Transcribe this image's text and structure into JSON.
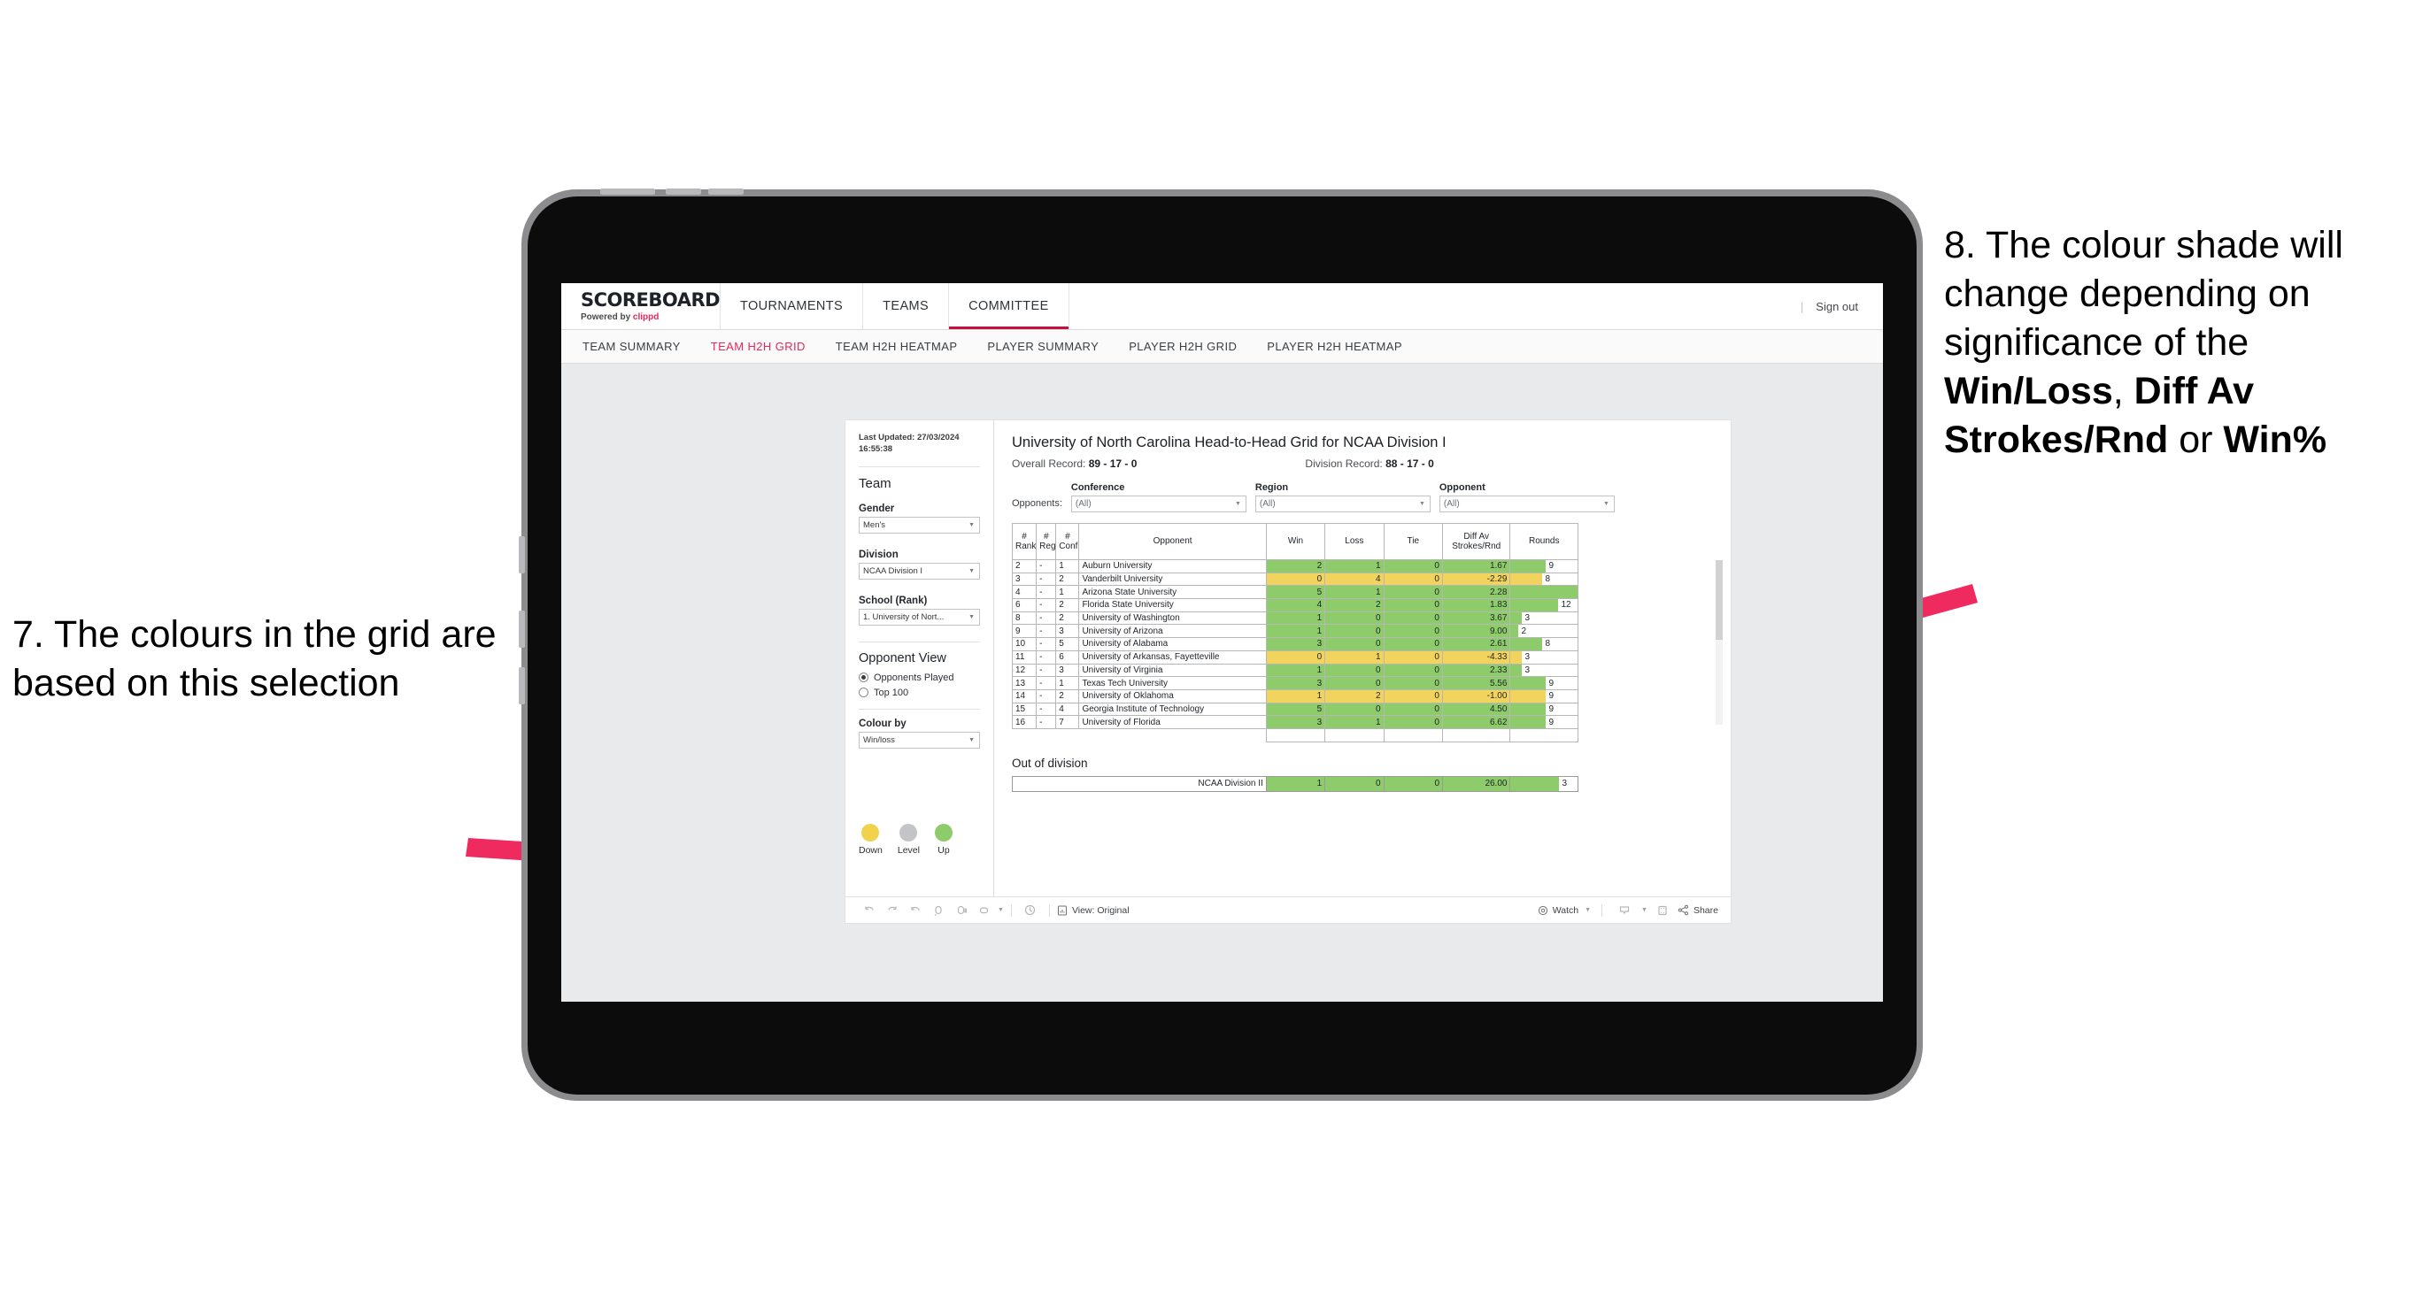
{
  "annotations": {
    "left": "7. The colours in the grid are based on this selection",
    "right_pre": "8. The colour shade will change depending on significance of the ",
    "right_b1": "Win/Loss",
    "right_mid1": ", ",
    "right_b2": "Diff Av Strokes/Rnd",
    "right_mid2": " or ",
    "right_b3": "Win%",
    "arrow_color": "#ee2a5f"
  },
  "app": {
    "brand": {
      "name": "SCOREBOARD",
      "sub_prefix": "Powered by ",
      "sub_brand": "clippd"
    },
    "topnav": [
      {
        "label": "TOURNAMENTS",
        "active": false
      },
      {
        "label": "TEAMS",
        "active": false
      },
      {
        "label": "COMMITTEE",
        "active": true
      }
    ],
    "signout": "Sign out",
    "subnav": [
      {
        "label": "TEAM SUMMARY",
        "active": false
      },
      {
        "label": "TEAM H2H GRID",
        "active": true
      },
      {
        "label": "TEAM H2H HEATMAP",
        "active": false
      },
      {
        "label": "PLAYER SUMMARY",
        "active": false
      },
      {
        "label": "PLAYER H2H GRID",
        "active": false
      },
      {
        "label": "PLAYER H2H HEATMAP",
        "active": false
      }
    ]
  },
  "sidebar": {
    "last_updated": "Last Updated: 27/03/2024 16:55:38",
    "team_heading": "Team",
    "gender_label": "Gender",
    "gender_value": "Men's",
    "division_label": "Division",
    "division_value": "NCAA Division I",
    "school_label": "School (Rank)",
    "school_value": "1. University of Nort...",
    "opponent_view_heading": "Opponent View",
    "opt_opponents_played": "Opponents Played",
    "opt_top100": "Top 100",
    "colour_by_label": "Colour by",
    "colour_by_value": "Win/loss",
    "legend": [
      {
        "label": "Down",
        "color": "#f2d24b"
      },
      {
        "label": "Level",
        "color": "#c2c4c8"
      },
      {
        "label": "Up",
        "color": "#8ecb6a"
      }
    ]
  },
  "viz": {
    "title": "University of North Carolina Head-to-Head Grid for NCAA Division I",
    "overall_label": "Overall Record: ",
    "overall_value": "89 - 17 - 0",
    "division_label": "Division Record: ",
    "division_value": "88 - 17 - 0",
    "opponents_label": "Opponents:",
    "filters": [
      {
        "caption": "Conference",
        "value": "(All)"
      },
      {
        "caption": "Region",
        "value": "(All)"
      },
      {
        "caption": "Opponent",
        "value": "(All)"
      }
    ],
    "out_of_division_heading": "Out of division",
    "toolbar": {
      "view_label": "View: Original",
      "watch_label": "Watch",
      "share_label": "Share"
    }
  },
  "chart_data": {
    "type": "table",
    "title": "University of North Carolina Head-to-Head Grid for NCAA Division I",
    "columns": [
      "# Rank",
      "# Reg",
      "# Conf",
      "Opponent",
      "Win",
      "Loss",
      "Tie",
      "Diff Av Strokes/Rnd",
      "Rounds"
    ],
    "header_lines": [
      [
        "#",
        "Rank"
      ],
      [
        "#",
        "Reg"
      ],
      [
        "#",
        "Conf"
      ],
      [
        "",
        "Opponent"
      ],
      [
        "",
        "Win"
      ],
      [
        "",
        "Loss"
      ],
      [
        "",
        "Tie"
      ],
      [
        "Diff Av",
        "Strokes/Rnd"
      ],
      [
        "",
        "Rounds"
      ]
    ],
    "colors": {
      "up": "#8ecb6a",
      "down": "#f2d35e",
      "level": "#c2c4c8"
    },
    "rounds_max": 17,
    "rows": [
      {
        "rank": "2",
        "reg": "-",
        "conf": "1",
        "opponent": "Auburn University",
        "win": "2",
        "loss": "1",
        "tie": "0",
        "diff": "1.67",
        "rounds": 9,
        "state": "up"
      },
      {
        "rank": "3",
        "reg": "-",
        "conf": "2",
        "opponent": "Vanderbilt University",
        "win": "0",
        "loss": "4",
        "tie": "0",
        "diff": "-2.29",
        "rounds": 8,
        "state": "down"
      },
      {
        "rank": "4",
        "reg": "-",
        "conf": "1",
        "opponent": "Arizona State University",
        "win": "5",
        "loss": "1",
        "tie": "0",
        "diff": "2.28",
        "rounds": 17,
        "state": "up"
      },
      {
        "rank": "6",
        "reg": "-",
        "conf": "2",
        "opponent": "Florida State University",
        "win": "4",
        "loss": "2",
        "tie": "0",
        "diff": "1.83",
        "rounds": 12,
        "state": "up"
      },
      {
        "rank": "8",
        "reg": "-",
        "conf": "2",
        "opponent": "University of Washington",
        "win": "1",
        "loss": "0",
        "tie": "0",
        "diff": "3.67",
        "rounds": 3,
        "state": "up"
      },
      {
        "rank": "9",
        "reg": "-",
        "conf": "3",
        "opponent": "University of Arizona",
        "win": "1",
        "loss": "0",
        "tie": "0",
        "diff": "9.00",
        "rounds": 2,
        "state": "up"
      },
      {
        "rank": "10",
        "reg": "-",
        "conf": "5",
        "opponent": "University of Alabama",
        "win": "3",
        "loss": "0",
        "tie": "0",
        "diff": "2.61",
        "rounds": 8,
        "state": "up"
      },
      {
        "rank": "11",
        "reg": "-",
        "conf": "6",
        "opponent": "University of Arkansas, Fayetteville",
        "win": "0",
        "loss": "1",
        "tie": "0",
        "diff": "-4.33",
        "rounds": 3,
        "state": "down"
      },
      {
        "rank": "12",
        "reg": "-",
        "conf": "3",
        "opponent": "University of Virginia",
        "win": "1",
        "loss": "0",
        "tie": "0",
        "diff": "2.33",
        "rounds": 3,
        "state": "up"
      },
      {
        "rank": "13",
        "reg": "-",
        "conf": "1",
        "opponent": "Texas Tech University",
        "win": "3",
        "loss": "0",
        "tie": "0",
        "diff": "5.56",
        "rounds": 9,
        "state": "up"
      },
      {
        "rank": "14",
        "reg": "-",
        "conf": "2",
        "opponent": "University of Oklahoma",
        "win": "1",
        "loss": "2",
        "tie": "0",
        "diff": "-1.00",
        "rounds": 9,
        "state": "down"
      },
      {
        "rank": "15",
        "reg": "-",
        "conf": "4",
        "opponent": "Georgia Institute of Technology",
        "win": "5",
        "loss": "0",
        "tie": "0",
        "diff": "4.50",
        "rounds": 9,
        "state": "up"
      },
      {
        "rank": "16",
        "reg": "-",
        "conf": "7",
        "opponent": "University of Florida",
        "win": "3",
        "loss": "1",
        "tie": "0",
        "diff": "6.62",
        "rounds": 9,
        "state": "up"
      }
    ],
    "out_of_division": [
      {
        "opponent": "NCAA Division II",
        "win": "1",
        "loss": "0",
        "tie": "0",
        "diff": "26.00",
        "rounds": 3,
        "state": "up"
      }
    ]
  }
}
